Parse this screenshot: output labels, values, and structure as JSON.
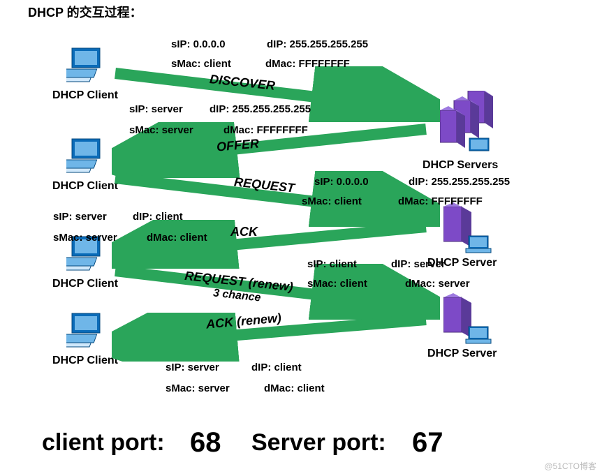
{
  "title": "DHCP 的交互过程：",
  "clients": {
    "label": "DHCP Client"
  },
  "servers": {
    "multi": "DHCP Servers",
    "single": "DHCP Server"
  },
  "steps": {
    "discover": {
      "msg": "DISCOVER",
      "sip": "sIP: 0.0.0.0",
      "dip": "dIP: 255.255.255.255",
      "smac": "sMac: client",
      "dmac": "dMac: FFFFFFFF"
    },
    "offer": {
      "msg": "OFFER",
      "sip": "sIP: server",
      "dip": "dIP: 255.255.255.255",
      "smac": "sMac: server",
      "dmac": "dMac: FFFFFFFF"
    },
    "request": {
      "msg": "REQUEST",
      "sip": "sIP: 0.0.0.0",
      "dip": "dIP: 255.255.255.255",
      "smac": "sMac: client",
      "dmac": "dMac: FFFFFFFF"
    },
    "ack": {
      "msg": "ACK",
      "sip": "sIP: server",
      "dip": "dIP: client",
      "smac": "sMac: server",
      "dmac": "dMac: client"
    },
    "renew_request": {
      "msg": "REQUEST (renew)",
      "chance": "3 chance",
      "sip": "sIP: client",
      "dip": "dIP: server",
      "smac": "sMac: client",
      "dmac": "dMac: server"
    },
    "renew_ack": {
      "msg": "ACK (renew)",
      "sip": "sIP: server",
      "dip": "dIP: client",
      "smac": "sMac: server",
      "dmac": "dMac: client"
    }
  },
  "ports": {
    "client_label": "client port:",
    "client_value": "68",
    "server_label": "Server port:",
    "server_value": "67"
  },
  "watermark": "@51CTO博客"
}
